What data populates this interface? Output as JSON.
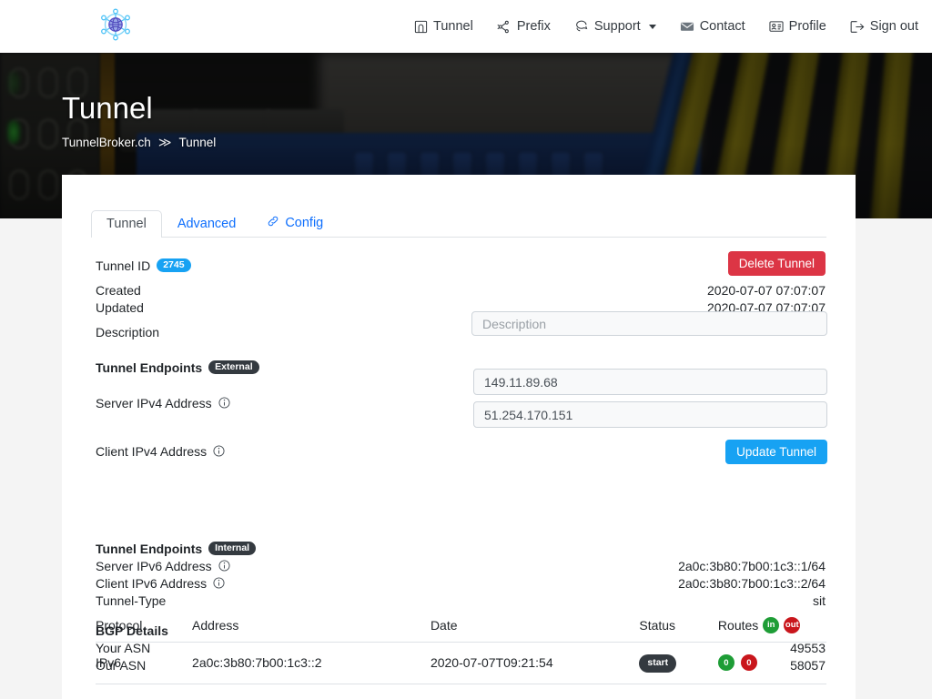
{
  "navbar": {
    "brand_icon": "globe-network-logo",
    "links": [
      {
        "label": "Tunnel",
        "icon": "tunnel-arch-icon",
        "caret": false
      },
      {
        "label": "Prefix",
        "icon": "prefix-nodes-icon",
        "caret": false
      },
      {
        "label": "Support",
        "icon": "chat-bubbles-icon",
        "caret": true
      },
      {
        "label": "Contact",
        "icon": "envelope-icon",
        "caret": false
      },
      {
        "label": "Profile",
        "icon": "id-card-icon",
        "caret": false
      },
      {
        "label": "Sign out",
        "icon": "sign-out-icon",
        "caret": false
      }
    ]
  },
  "hero": {
    "title": "Tunnel",
    "breadcrumb": {
      "root": "TunnelBroker.ch",
      "separator": "≫",
      "current": "Tunnel"
    }
  },
  "tabs": [
    {
      "label": "Tunnel",
      "active": true,
      "icon": null
    },
    {
      "label": "Advanced",
      "active": false,
      "icon": null
    },
    {
      "label": "Config",
      "active": false,
      "icon": "link-chain-icon"
    }
  ],
  "details": {
    "tunnel_id_label": "Tunnel ID",
    "tunnel_id_value": "2745",
    "created_label": "Created",
    "created_value": "2020-07-07 07:07:07",
    "updated_label": "Updated",
    "updated_value": "2020-07-07 07:07:07",
    "description_label": "Description",
    "description_value": "",
    "description_placeholder": "Description",
    "delete_button": "Delete Tunnel",
    "update_button": "Update Tunnel"
  },
  "endpoints_external": {
    "heading": "Tunnel Endpoints",
    "badge": "External",
    "server_label": "Server IPv4 Address",
    "server_value": "149.11.89.68",
    "client_label": "Client IPv4 Address",
    "client_value": "51.254.170.151"
  },
  "endpoints_internal": {
    "heading": "Tunnel Endpoints",
    "badge": "Internal",
    "server_label": "Server IPv6 Address",
    "server_value": "2a0c:3b80:7b00:1c3::1/64",
    "client_label": "Client IPv6 Address",
    "client_value": "2a0c:3b80:7b00:1c3::2/64",
    "type_label": "Tunnel-Type",
    "type_value": "sit"
  },
  "bgp": {
    "heading": "BGP Details",
    "your_asn_label": "Your ASN",
    "your_asn_value": "49553",
    "our_asn_label": "Our ASN",
    "our_asn_value": "58057"
  },
  "sessions_table": {
    "headers": {
      "protocol": "Protocol",
      "address": "Address",
      "date": "Date",
      "status": "Status",
      "routes": "Routes",
      "routes_in": "in",
      "routes_out": "out"
    },
    "rows": [
      {
        "protocol": "IPv6",
        "address": "2a0c:3b80:7b00:1c3::2",
        "date": "2020-07-07T09:21:54",
        "status": "start",
        "routes_in": "0",
        "routes_out": "0"
      }
    ]
  },
  "colors": {
    "accent_blue": "#17a2f3",
    "link_blue": "#0d6efd",
    "danger_red": "#dc3545",
    "dark": "#343a40",
    "route_in_green": "#1e9d36",
    "route_out_red": "#c9161c"
  }
}
